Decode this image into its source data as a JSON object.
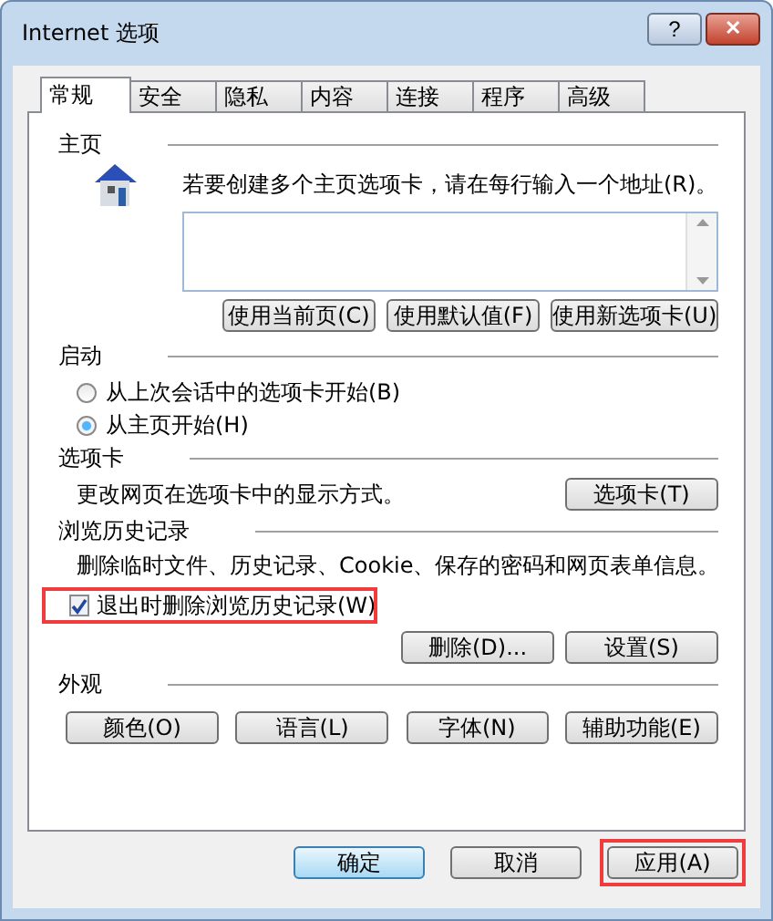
{
  "window": {
    "title": "Internet 选项",
    "help_button": "?",
    "close_button": "✕"
  },
  "tabs": [
    {
      "label": "常规",
      "selected": true
    },
    {
      "label": "安全",
      "selected": false
    },
    {
      "label": "隐私",
      "selected": false
    },
    {
      "label": "内容",
      "selected": false
    },
    {
      "label": "连接",
      "selected": false
    },
    {
      "label": "程序",
      "selected": false
    },
    {
      "label": "高级",
      "selected": false
    }
  ],
  "home_page": {
    "heading": "主页",
    "instruction": "若要创建多个主页选项卡，请在每行输入一个地址(R)。",
    "buttons": [
      "使用当前页(C)",
      "使用默认值(F)",
      "使用新选项卡(U)"
    ]
  },
  "startup": {
    "heading": "启动",
    "options": [
      {
        "label": "从上次会话中的选项卡开始(B)",
        "selected": false
      },
      {
        "label": "从主页开始(H)",
        "selected": true
      }
    ]
  },
  "tabs_section": {
    "heading": "选项卡",
    "description": "更改网页在选项卡中的显示方式。",
    "button": "选项卡(T)"
  },
  "history": {
    "heading": "浏览历史记录",
    "description": "删除临时文件、历史记录、Cookie、保存的密码和网页表单信息。",
    "delete_on_exit": {
      "label": "退出时删除浏览历史记录(W)",
      "checked": true,
      "highlighted": true
    },
    "buttons": [
      "删除(D)...",
      "设置(S)"
    ]
  },
  "appearance": {
    "heading": "外观",
    "buttons": [
      "颜色(O)",
      "语言(L)",
      "字体(N)",
      "辅助功能(E)"
    ]
  },
  "footer_buttons": [
    {
      "label": "确定",
      "default": true,
      "highlighted": false
    },
    {
      "label": "取消",
      "default": false,
      "highlighted": false
    },
    {
      "label": "应用(A)",
      "default": false,
      "highlighted": true
    }
  ]
}
